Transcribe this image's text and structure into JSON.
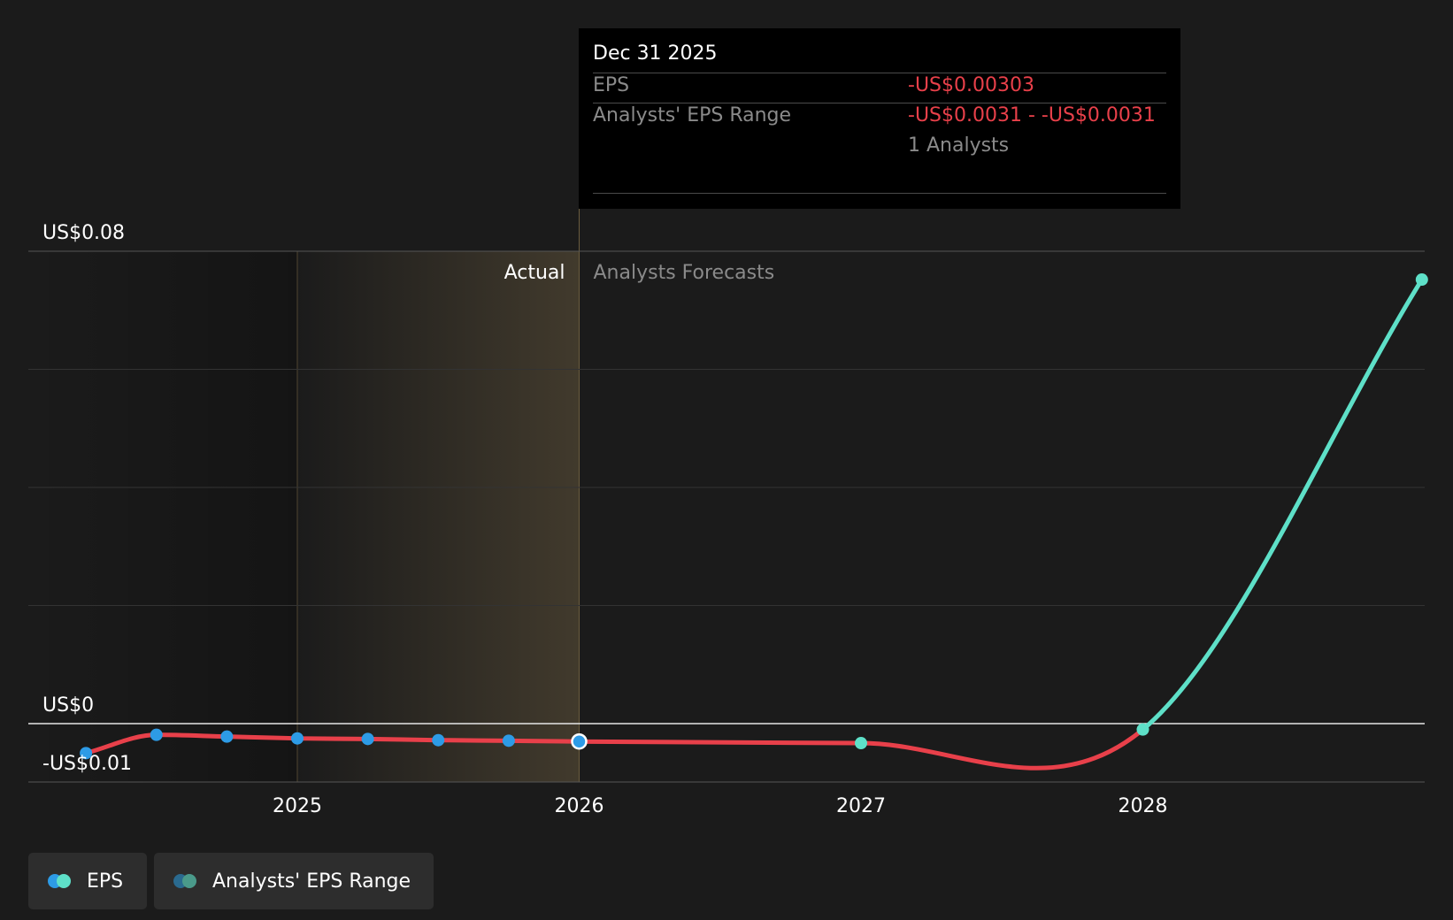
{
  "tooltip": {
    "date": "Dec 31 2025",
    "eps_label": "EPS",
    "eps_value": "-US$0.00303",
    "range_label": "Analysts' EPS Range",
    "range_value": "-US$0.0031 - -US$0.0031",
    "analysts": "1 Analysts"
  },
  "legend": [
    {
      "label": "EPS",
      "colors": [
        "#2d9be6",
        "#5ee0c8"
      ]
    },
    {
      "label": "Analysts' EPS Range",
      "colors": [
        "#2a6a8f",
        "#4a9a8a"
      ]
    }
  ],
  "chart_data": {
    "type": "line",
    "section_labels": {
      "actual": "Actual",
      "forecast": "Analysts Forecasts"
    },
    "y_ticks": [
      {
        "value": 0.08,
        "label": "US$0.08"
      },
      {
        "value": 0,
        "label": "US$0"
      },
      {
        "value": -0.01,
        "label": "-US$0.01"
      }
    ],
    "ylim": [
      -0.01,
      0.08
    ],
    "x_ticks": [
      {
        "value": 2025.0,
        "label": "2025"
      },
      {
        "value": 2026.0,
        "label": "2026"
      },
      {
        "value": 2027.0,
        "label": "2027"
      },
      {
        "value": 2028.0,
        "label": "2028"
      }
    ],
    "xlim": [
      2024.05,
      2028.99
    ],
    "actual_shade_start": 2025.0,
    "forecast_start": 2026.0,
    "grid": true,
    "series": [
      {
        "name": "EPS",
        "color_actual": "#2d9be6",
        "color_forecast": "#5ee0c8",
        "line_color": "#e8404a",
        "points": [
          {
            "x": 2024.25,
            "y": -0.005,
            "kind": "actual"
          },
          {
            "x": 2024.5,
            "y": -0.0019,
            "kind": "actual"
          },
          {
            "x": 2024.75,
            "y": -0.0022,
            "kind": "actual"
          },
          {
            "x": 2025.0,
            "y": -0.0025,
            "kind": "actual"
          },
          {
            "x": 2025.25,
            "y": -0.0026,
            "kind": "actual"
          },
          {
            "x": 2025.5,
            "y": -0.0028,
            "kind": "actual"
          },
          {
            "x": 2025.75,
            "y": -0.0029,
            "kind": "actual"
          },
          {
            "x": 2026.0,
            "y": -0.00303,
            "kind": "highlight"
          },
          {
            "x": 2027.0,
            "y": -0.0033,
            "kind": "forecast"
          },
          {
            "x": 2028.0,
            "y": -0.001,
            "kind": "forecast"
          },
          {
            "x": 2028.99,
            "y": 0.0752,
            "kind": "forecast"
          }
        ]
      }
    ]
  }
}
